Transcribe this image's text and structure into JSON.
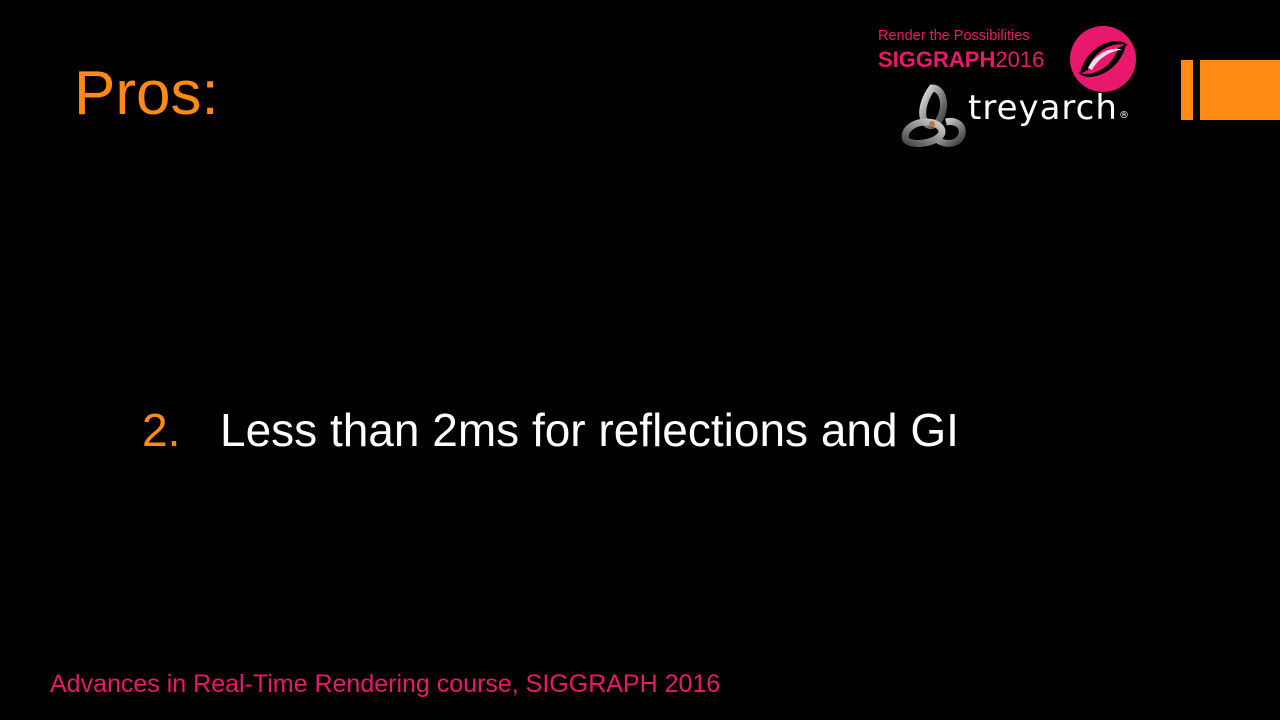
{
  "slide": {
    "title": "Pros:",
    "bullets": [
      {
        "number": "2.",
        "text": "Less than 2ms for reflections and GI"
      }
    ],
    "footer": "Advances in Real-Time Rendering course, SIGGRAPH 2016"
  },
  "logos": {
    "siggraph": {
      "tagline": "Render the Possibilities",
      "name": "SIGGRAPH",
      "year": "2016"
    },
    "treyarch": {
      "wordmark": "treyarch",
      "registered": "®"
    }
  },
  "colors": {
    "background": "#000000",
    "title": "#FF8A14",
    "bullet_number": "#FF8A14",
    "bullet_text": "#FFFFFF",
    "footer": "#E8196D",
    "siggraph_brand": "#E8196D",
    "accent_bar": "#FF8A14"
  },
  "icons": [
    "siggraph-swirl-icon",
    "treyarch-knot-icon"
  ]
}
